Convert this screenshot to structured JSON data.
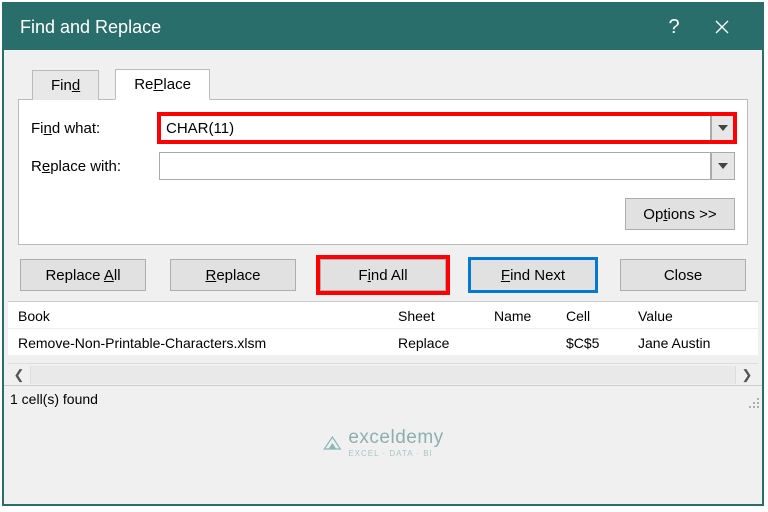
{
  "titlebar": {
    "title": "Find and Replace"
  },
  "tabs": {
    "find": "d",
    "find_prefix": "Fin",
    "replace": "P",
    "replace_prefix": "Re",
    "replace_suffix": "lace"
  },
  "form": {
    "find_what_prefix": "Fi",
    "find_what_ul": "n",
    "find_what_suffix": "d what:",
    "find_what_value": "CHAR(11)",
    "replace_with_prefix": "R",
    "replace_with_ul": "e",
    "replace_with_suffix": "place with:",
    "replace_with_value": ""
  },
  "options_button": {
    "prefix": "Op",
    "ul": "t",
    "suffix": "ions >>"
  },
  "buttons": {
    "replace_all_prefix": "Replace ",
    "replace_all_ul": "A",
    "replace_all_suffix": "ll",
    "replace_ul": "R",
    "replace_suffix": "eplace",
    "find_all_prefix": "F",
    "find_all_ul": "i",
    "find_all_suffix": "nd All",
    "find_next_ul": "F",
    "find_next_suffix": "ind Next",
    "close": "Close"
  },
  "results": {
    "book_h": "Book",
    "sheet_h": "Sheet",
    "name_h": "Name",
    "cell_h": "Cell",
    "value_h": "Value",
    "row": {
      "book": "Remove-Non-Printable-Characters.xlsm",
      "sheet": "Replace",
      "name": "",
      "cell": "$C$5",
      "value": "Jane Austin​"
    }
  },
  "status": "1 cell(s) found",
  "watermark": {
    "brand": "exceldemy",
    "tag": "EXCEL · DATA · BI"
  }
}
